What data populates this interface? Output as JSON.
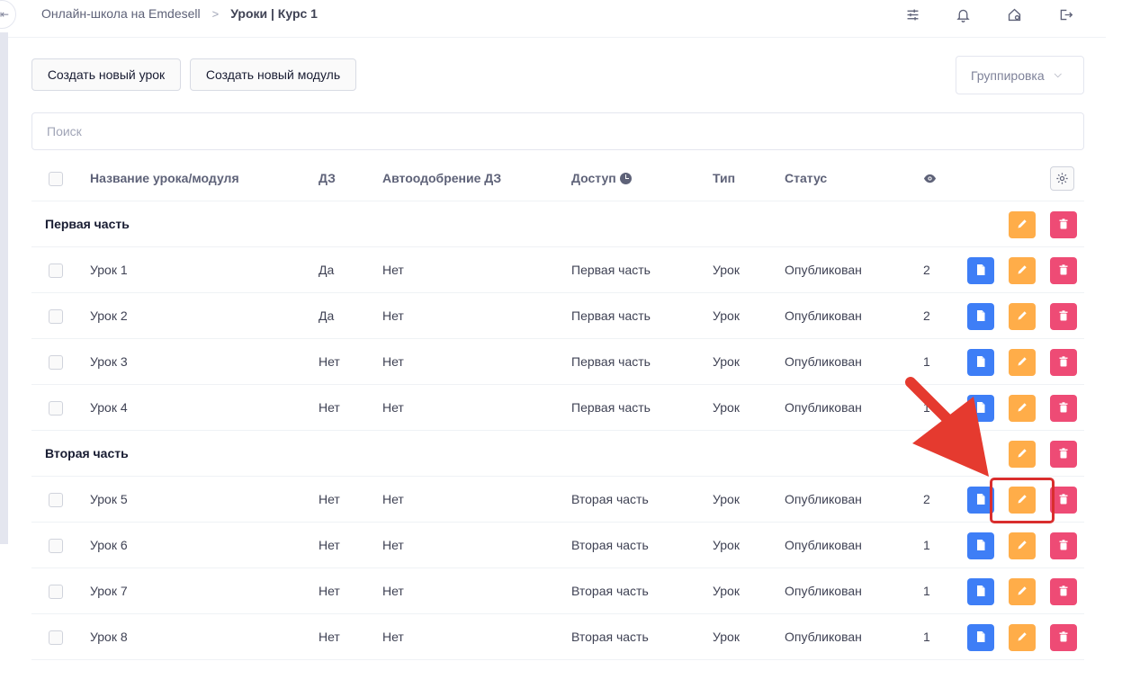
{
  "breadcrumb": {
    "parent": "Онлайн-школа на Emdesell",
    "separator": ">",
    "current": "Уроки | Курс 1"
  },
  "topbar_icons": [
    "sliders-icon",
    "bell-icon",
    "home-gear-icon",
    "logout-icon"
  ],
  "collapse_glyph": "⇤",
  "toolbar": {
    "new_lesson": "Создать новый урок",
    "new_module": "Создать новый модуль",
    "grouping": "Группировка"
  },
  "search": {
    "placeholder": "Поиск",
    "value": ""
  },
  "columns": {
    "name": "Название урока/модуля",
    "hw": "ДЗ",
    "auto": "Автоодобрение ДЗ",
    "access": "Доступ",
    "type": "Тип",
    "status": "Статус"
  },
  "groups": [
    {
      "title": "Первая часть",
      "lessons": [
        {
          "name": "Урок 1",
          "hw": "Да",
          "auto": "Нет",
          "access": "Первая часть",
          "type": "Урок",
          "status": "Опубликован",
          "views": "2"
        },
        {
          "name": "Урок 2",
          "hw": "Да",
          "auto": "Нет",
          "access": "Первая часть",
          "type": "Урок",
          "status": "Опубликован",
          "views": "2"
        },
        {
          "name": "Урок 3",
          "hw": "Нет",
          "auto": "Нет",
          "access": "Первая часть",
          "type": "Урок",
          "status": "Опубликован",
          "views": "1"
        },
        {
          "name": "Урок 4",
          "hw": "Нет",
          "auto": "Нет",
          "access": "Первая часть",
          "type": "Урок",
          "status": "Опубликован",
          "views": "1"
        }
      ]
    },
    {
      "title": "Вторая часть",
      "lessons": [
        {
          "name": "Урок 5",
          "hw": "Нет",
          "auto": "Нет",
          "access": "Вторая часть",
          "type": "Урок",
          "status": "Опубликован",
          "views": "2"
        },
        {
          "name": "Урок 6",
          "hw": "Нет",
          "auto": "Нет",
          "access": "Вторая часть",
          "type": "Урок",
          "status": "Опубликован",
          "views": "1"
        },
        {
          "name": "Урок 7",
          "hw": "Нет",
          "auto": "Нет",
          "access": "Вторая часть",
          "type": "Урок",
          "status": "Опубликован",
          "views": "1"
        },
        {
          "name": "Урок 8",
          "hw": "Нет",
          "auto": "Нет",
          "access": "Вторая часть",
          "type": "Урок",
          "status": "Опубликован",
          "views": "1"
        }
      ]
    }
  ],
  "colors": {
    "doc_button": "#3e7ef6",
    "edit_button": "#ffad49",
    "delete_button": "#ee4b75",
    "annotation_red": "#d92e2e"
  }
}
